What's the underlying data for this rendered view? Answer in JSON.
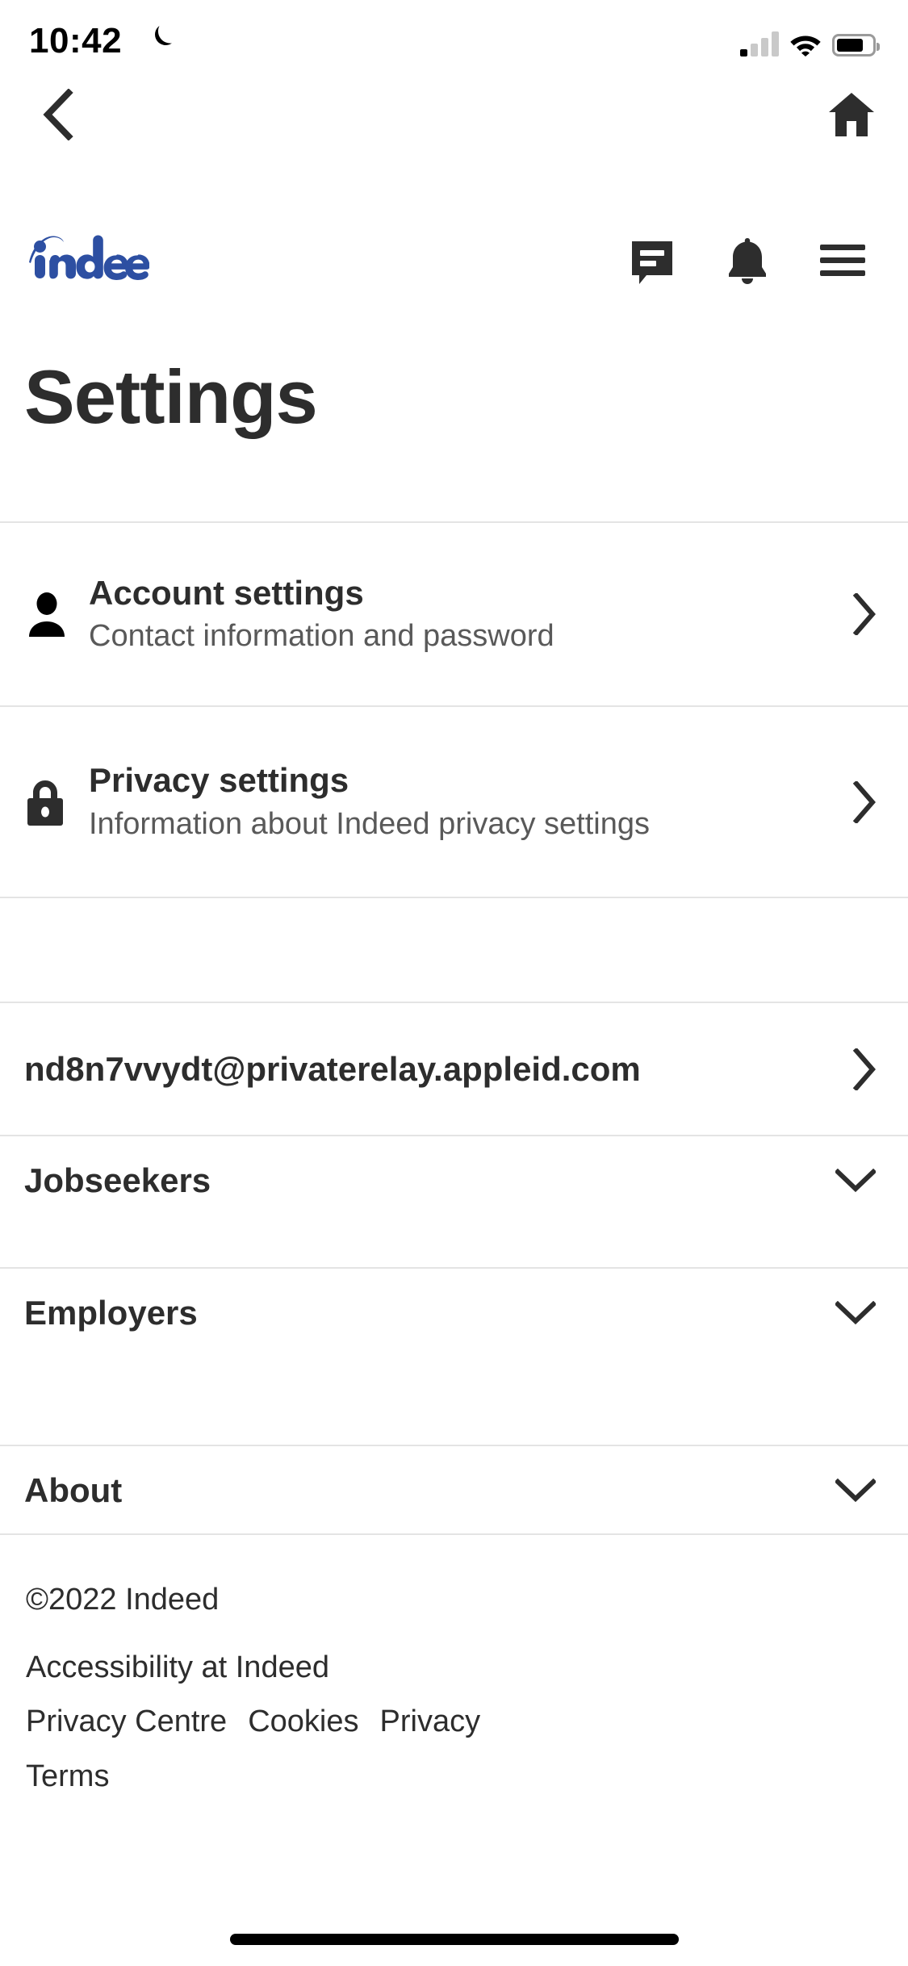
{
  "status_bar": {
    "time": "10:42",
    "dnd_icon": "crescent-moon-icon",
    "signal_icon": "cellular-signal-icon",
    "wifi_icon": "wifi-icon",
    "battery_icon": "battery-icon",
    "battery_level": "75"
  },
  "browser_nav": {
    "back_icon": "chevron-left-icon",
    "home_icon": "home-icon"
  },
  "site_header": {
    "logo_text": "indeed",
    "logo_color": "#2D4FA2",
    "actions": [
      {
        "name": "messages",
        "icon": "message-bubble-icon"
      },
      {
        "name": "notifications",
        "icon": "bell-icon"
      },
      {
        "name": "menu",
        "icon": "hamburger-menu-icon"
      }
    ]
  },
  "page": {
    "title": "Settings"
  },
  "menu": {
    "items": [
      {
        "icon": "person-icon",
        "title": "Account settings",
        "subtitle": "Contact information and password",
        "chevron": "chevron-right-icon"
      },
      {
        "icon": "lock-icon",
        "title": "Privacy settings",
        "subtitle": "Information about Indeed privacy settings",
        "chevron": "chevron-right-icon"
      }
    ]
  },
  "account": {
    "email": "nd8n7vvydt@privaterelay.appleid.com",
    "chevron": "chevron-right-icon"
  },
  "accordions": [
    {
      "label": "Jobseekers",
      "chevron": "chevron-down-icon"
    },
    {
      "label": "Employers",
      "chevron": "chevron-down-icon"
    },
    {
      "label": "About",
      "chevron": "chevron-down-icon"
    }
  ],
  "footer": {
    "copyright": "©2022 Indeed",
    "links": [
      "Accessibility at Indeed",
      "Privacy Centre",
      "Cookies",
      "Privacy",
      "Terms"
    ]
  },
  "colors": {
    "text_primary": "#2D2D2D",
    "text_secondary": "#595959",
    "divider": "#E4E4E4",
    "brand_blue": "#2D4FA2"
  }
}
